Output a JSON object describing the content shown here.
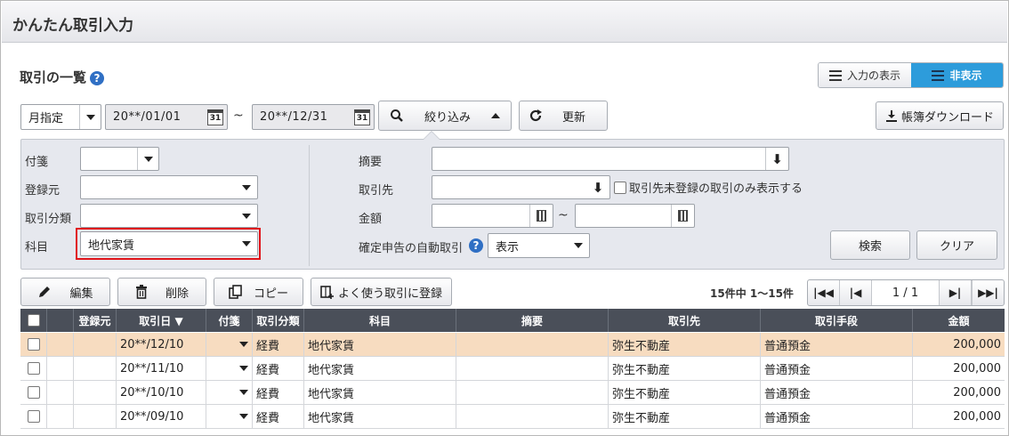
{
  "app": {
    "title": "かんたん取引入力"
  },
  "section": {
    "title": "取引の一覧",
    "help": "?"
  },
  "view_toggle": {
    "show_label": "入力の表示",
    "hide_label": "非表示"
  },
  "date_filter": {
    "period_select": "月指定",
    "from": "20**/01/01",
    "to": "20**/12/31",
    "tilde": "~",
    "cal_glyph": "31"
  },
  "toolbar": {
    "narrow_label": "絞り込み",
    "refresh_label": "更新",
    "download_label": "帳簿ダウンロード"
  },
  "filters": {
    "fusen_label": "付箋",
    "fusen_value": "",
    "source_label": "登録元",
    "source_value": "",
    "category_label": "取引分類",
    "category_value": "",
    "account_label": "科目",
    "account_value": "地代家賃",
    "summary_label": "摘要",
    "summary_value": "",
    "partner_label": "取引先",
    "partner_value": "",
    "partner_unregistered_label": "取引先未登録の取引のみ表示する",
    "amount_label": "金額",
    "amount_tilde": "~",
    "auto_label": "確定申告の自動取引",
    "auto_value": "表示",
    "search_label": "検索",
    "clear_label": "クリア"
  },
  "actions": {
    "edit_label": "編集",
    "delete_label": "削除",
    "copy_label": "コピー",
    "favorite_label": "よく使う取引に登録"
  },
  "pagination": {
    "summary": "15件中 1～15件",
    "page": "1  /  1"
  },
  "table": {
    "columns": [
      "",
      "",
      "登録元",
      "取引日 ▼",
      "付箋",
      "取引分類",
      "科目",
      "摘要",
      "取引先",
      "取引手段",
      "金額"
    ],
    "rows": [
      {
        "date": "20**/12/10",
        "category": "経費",
        "account": "地代家賃",
        "summary": "",
        "partner": "弥生不動産",
        "method": "普通預金",
        "amount": "200,000"
      },
      {
        "date": "20**/11/10",
        "category": "経費",
        "account": "地代家賃",
        "summary": "",
        "partner": "弥生不動産",
        "method": "普通預金",
        "amount": "200,000"
      },
      {
        "date": "20**/10/10",
        "category": "経費",
        "account": "地代家賃",
        "summary": "",
        "partner": "弥生不動産",
        "method": "普通預金",
        "amount": "200,000"
      },
      {
        "date": "20**/09/10",
        "category": "経費",
        "account": "地代家賃",
        "summary": "",
        "partner": "弥生不動産",
        "method": "普通預金",
        "amount": "200,000"
      }
    ]
  },
  "colors": {
    "accent": "#2d9cdb",
    "header_bg": "#4a4f59",
    "selected_row": "#f7dcc0",
    "highlight_border": "#e0141a"
  }
}
